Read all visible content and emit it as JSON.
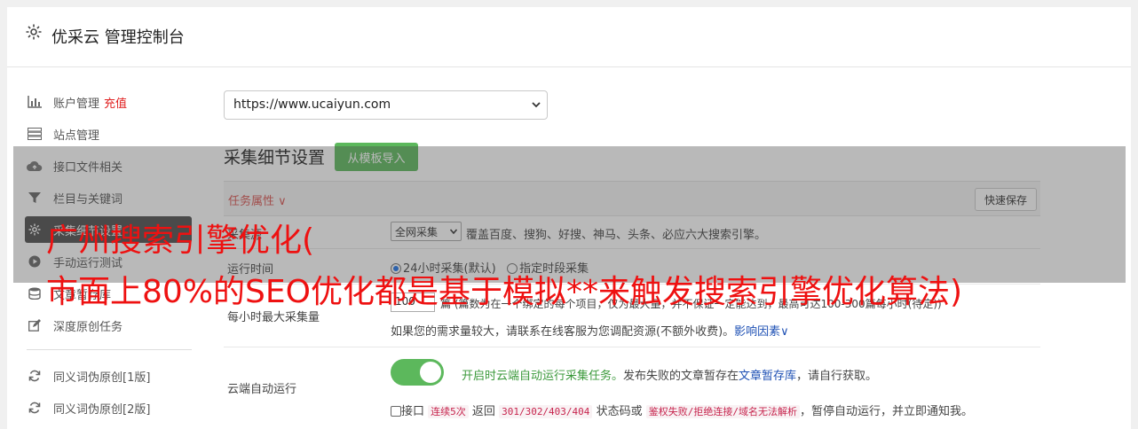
{
  "header": {
    "title": "优采云 管理控制台",
    "icon": "gear-icon"
  },
  "sidebar": {
    "items": [
      {
        "label": "账户管理",
        "extra": "充值",
        "icon": "bar-chart-icon"
      },
      {
        "label": "站点管理",
        "icon": "server-icon"
      },
      {
        "label": "接口文件相关",
        "icon": "cloud-upload-icon"
      },
      {
        "label": "栏目与关键词",
        "icon": "filter-icon"
      },
      {
        "label": "采集细节设置",
        "icon": "gear-icon"
      },
      {
        "label": "手动运行测试",
        "icon": "play-icon"
      },
      {
        "label": "文章暂存库",
        "icon": "database-icon"
      },
      {
        "label": "深度原创任务",
        "icon": "edit-icon"
      },
      {
        "label": "同义词伪原创[1版]",
        "icon": "refresh-icon"
      },
      {
        "label": "同义词伪原创[2版]",
        "icon": "refresh-icon"
      }
    ]
  },
  "site_select": {
    "value": "https://www.ucaiyun.com"
  },
  "section": {
    "title": "采集细节设置",
    "template_button": "从模板导入"
  },
  "task_props": {
    "label": "任务属性",
    "save_button": "快速保存"
  },
  "rows": {
    "source": {
      "label": "采集源",
      "select_value": "全网采集",
      "desc": "覆盖百度、搜狗、好搜、神马、头条、必应六大搜索引擎。"
    },
    "run_time": {
      "label": "运行时间",
      "option1": "24小时采集(默认)",
      "option2": "指定时段采集"
    },
    "max": {
      "label": "每小时最大采集量",
      "input_value": "100",
      "line1": "篇 (篇数为在一个绑定的每个项目，仅为最大量，并不保证一定能达到，最高可达100-300篇每小时(待定))",
      "line2": "如果您的需求量较大，请联系在线客服为您调配资源(不额外收费)。",
      "link": "影响因素"
    },
    "cloud": {
      "label": "云端自动运行",
      "desc_green": "开启时云端自动运行采集任务。",
      "desc": "发布失败的文章暂存在",
      "desc_link": "文章暂存库",
      "desc_tail": "，请自行获取。",
      "check_label": "接口",
      "code1": "连续5次",
      "mid1": "返回",
      "code2": "301/302/403/404",
      "mid2": "状态码或",
      "code3": "鉴权失败/拒绝连接/域名无法解析",
      "tail": "，暂停自动运行，并立即通知我。"
    }
  },
  "watermark": {
    "line1": "广州搜索引擎优化(",
    "line2": "市面上80%的SEO优化都是基于模拟**来触发搜索引擎优化算法)"
  },
  "colors": {
    "accent_green": "#5cb85c",
    "active_sidebar": "#4c4c4c",
    "alert_red": "#d9534f",
    "watermark_red": "#ee1111"
  }
}
